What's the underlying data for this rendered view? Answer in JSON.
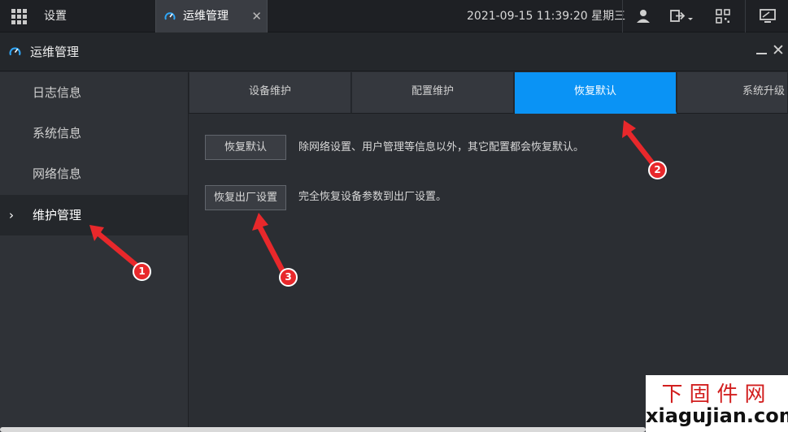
{
  "topbar": {
    "menu_icon": "grid-icon",
    "settings_label": "设置",
    "active_tab": {
      "label": "运维管理",
      "icon": "gauge-icon",
      "close": "✕"
    },
    "datetime": "2021-09-15 11:39:20 星期三",
    "icons": [
      "user-icon",
      "logout-icon",
      "qr-code-icon",
      "monitor-icon"
    ]
  },
  "window": {
    "title": "运维管理",
    "icon": "gauge-icon",
    "minimize": "—",
    "close": "✕"
  },
  "sidebar": {
    "items": [
      {
        "label": "日志信息"
      },
      {
        "label": "系统信息"
      },
      {
        "label": "网络信息"
      },
      {
        "label": "维护管理",
        "active": true,
        "chevron": "›"
      }
    ]
  },
  "main": {
    "tabs": [
      {
        "label": "设备维护"
      },
      {
        "label": "配置维护"
      },
      {
        "label": "恢复默认",
        "active": true
      },
      {
        "label": "系统升级"
      }
    ],
    "actions": [
      {
        "button": "恢复默认",
        "description": "除网络设置、用户管理等信息以外，其它配置都会恢复默认。"
      },
      {
        "button": "恢复出厂设置",
        "description": "完全恢复设备参数到出厂设置。"
      }
    ]
  },
  "annotations": {
    "markers": [
      "1",
      "2",
      "3"
    ],
    "color": "#e8282b"
  },
  "watermark": {
    "cn": "下固件网",
    "en": "xiagujian.com"
  },
  "colors": {
    "accent": "#0a93f5",
    "background": "#2b2e33",
    "topbar": "#1e2024"
  }
}
